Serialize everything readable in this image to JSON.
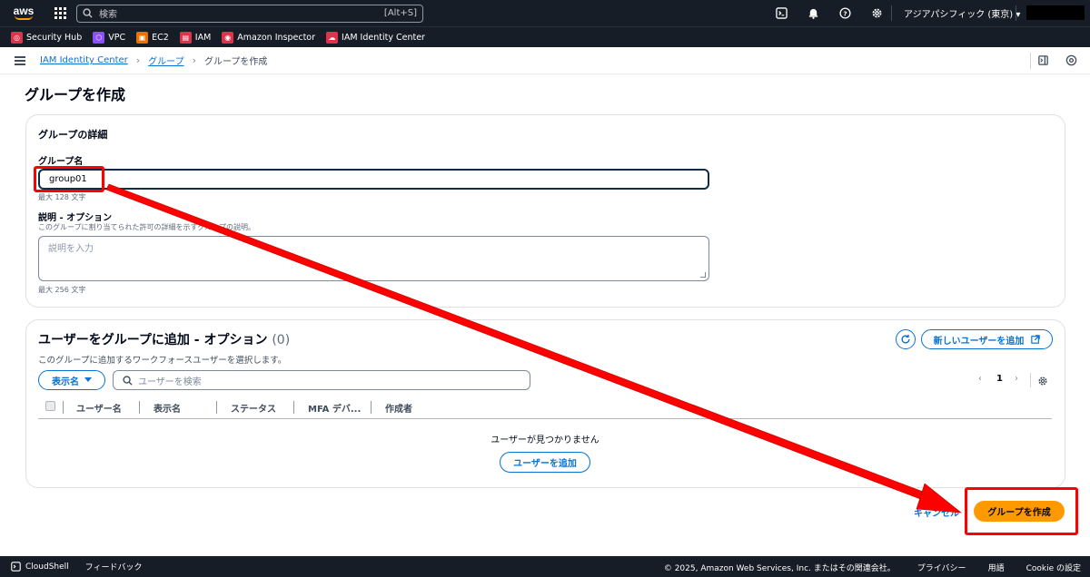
{
  "topnav": {
    "search_placeholder": "検索",
    "search_shortcut": "[Alt+S]",
    "region": "アジアパシフィック (東京) ▾"
  },
  "favorites": [
    {
      "label": "Security Hub",
      "color": "#dd344c",
      "icon": "security-hub-icon"
    },
    {
      "label": "VPC",
      "color": "#8c4fff",
      "icon": "vpc-icon"
    },
    {
      "label": "EC2",
      "color": "#ed7100",
      "icon": "ec2-icon"
    },
    {
      "label": "IAM",
      "color": "#dd344c",
      "icon": "iam-icon"
    },
    {
      "label": "Amazon Inspector",
      "color": "#dd344c",
      "icon": "inspector-icon"
    },
    {
      "label": "IAM Identity Center",
      "color": "#dd344c",
      "icon": "identity-center-icon"
    }
  ],
  "breadcrumb": {
    "root": "IAM Identity Center",
    "parent": "グループ",
    "current": "グループを作成"
  },
  "page": {
    "title": "グループを作成"
  },
  "details": {
    "heading": "グループの詳細",
    "name_label": "グループ名",
    "name_value": "group01",
    "name_hint": "最大 128 文字",
    "desc_label": "説明 - オプション",
    "desc_help": "このグループに割り当てられた許可の詳細を示すグループの説明。",
    "desc_placeholder": "説明を入力",
    "desc_hint": "最大 256 文字"
  },
  "users": {
    "heading": "ユーザーをグループに追加 - オプション",
    "count": "(0)",
    "help": "このグループに追加するワークフォースユーザーを選択します。",
    "new_user_button": "新しいユーザーを追加",
    "filter_dropdown": "表示名",
    "search_placeholder": "ユーザーを検索",
    "page_number": "1",
    "columns": [
      "ユーザー名",
      "表示名",
      "ステータス",
      "MFA デバ...",
      "作成者"
    ],
    "empty_text": "ユーザーが見つかりません",
    "add_user_button": "ユーザーを追加"
  },
  "actions": {
    "cancel": "キャンセル",
    "create": "グループを作成"
  },
  "footer": {
    "cloudshell": "CloudShell",
    "feedback": "フィードバック",
    "copyright": "© 2025, Amazon Web Services, Inc. またはその関連会社。",
    "privacy": "プライバシー",
    "terms": "用語",
    "cookie": "Cookie の設定"
  },
  "colors": {
    "accent": "#0972d3",
    "primary_button": "#ff9900",
    "annotation": "#ff0000",
    "nav_bg": "#161d26"
  }
}
